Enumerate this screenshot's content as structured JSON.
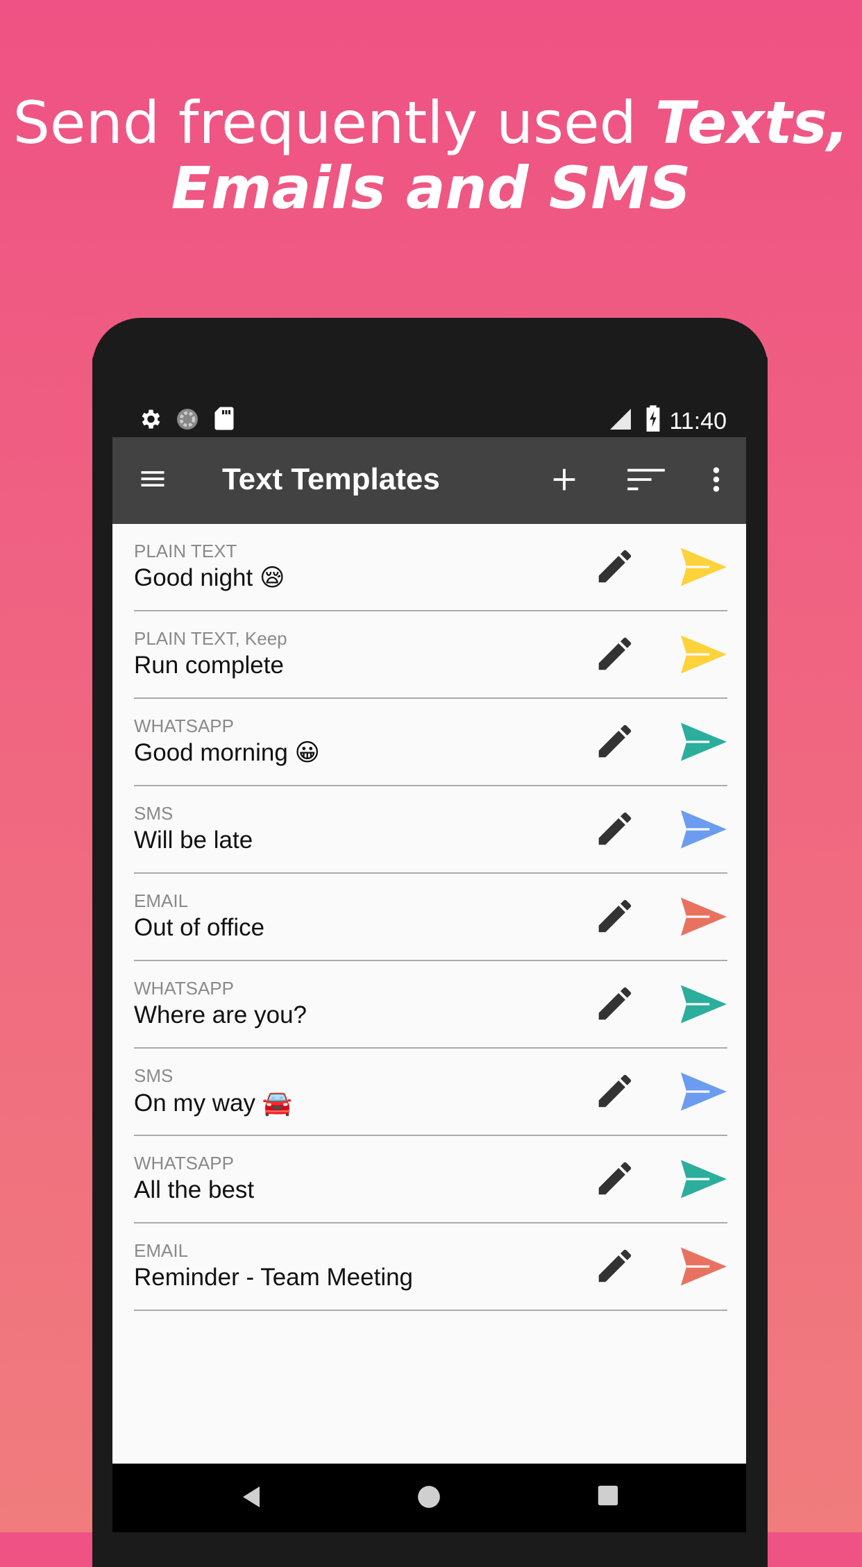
{
  "headline": {
    "line1_plain": "Send frequently used ",
    "line1_em": "Texts,",
    "line2_em": "Emails and SMS"
  },
  "statusbar": {
    "time": "11:40",
    "icons": [
      "gear-icon",
      "sync-icon",
      "sd-card-icon",
      "no-signal-icon",
      "battery-charging-icon"
    ]
  },
  "appbar": {
    "title": "Text Templates",
    "icons": [
      "menu-icon",
      "add-icon",
      "sort-icon",
      "more-vert-icon"
    ]
  },
  "templates": [
    {
      "type": "PLAIN TEXT",
      "name": "Good night 😪",
      "send_color": "#fdd23b"
    },
    {
      "type": "PLAIN TEXT, Keep",
      "name": "Run complete",
      "send_color": "#fdd23b"
    },
    {
      "type": "WHATSAPP",
      "name": "Good morning 😀",
      "send_color": "#2bae9c"
    },
    {
      "type": "SMS",
      "name": "Will be late",
      "send_color": "#6b9cf0"
    },
    {
      "type": "EMAIL",
      "name": "Out of office",
      "send_color": "#e8725f"
    },
    {
      "type": "WHATSAPP",
      "name": "Where are you?",
      "send_color": "#2bae9c"
    },
    {
      "type": "SMS",
      "name": "On my way 🚘",
      "send_color": "#6b9cf0"
    },
    {
      "type": "WHATSAPP",
      "name": "All the best",
      "send_color": "#2bae9c"
    },
    {
      "type": "EMAIL",
      "name": "Reminder - Team Meeting",
      "send_color": "#e8725f"
    }
  ],
  "colors": {
    "background_top": "#ef5284",
    "background_bottom": "#f07c7d",
    "appbar": "#424242",
    "list_bg": "#fafafa",
    "edit_icon": "#333333"
  },
  "navbar": {
    "icons": [
      "back-icon",
      "home-icon",
      "recents-icon"
    ]
  }
}
